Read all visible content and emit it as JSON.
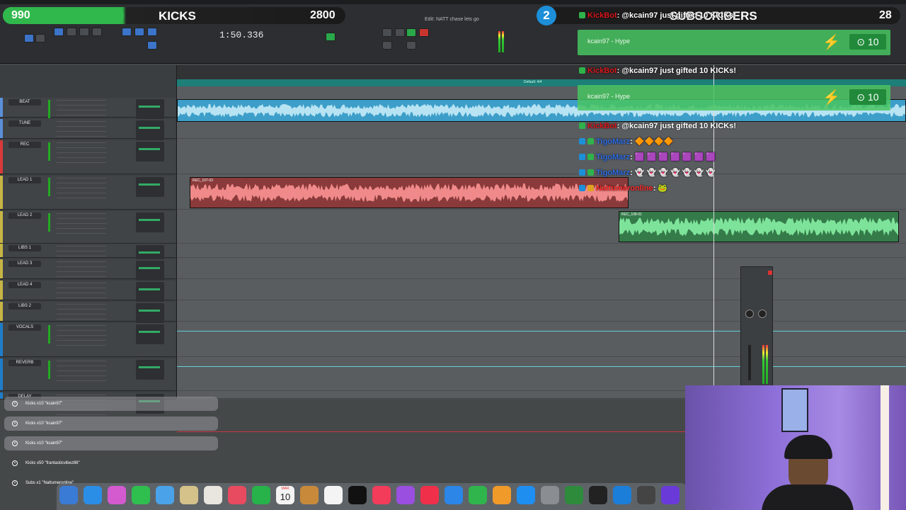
{
  "overlay": {
    "kicks": {
      "count": "990",
      "label": "KICKS",
      "goal": "2800",
      "progress": 0.354
    },
    "subs": {
      "count": "2",
      "label": "SUBSCRIBERS",
      "goal": "28"
    }
  },
  "transport": {
    "counter": "1:50.336",
    "edit_title": "Edit: NATT chase lets go",
    "default_meter": "Default: 4/4"
  },
  "tracks": [
    {
      "name": "BEAT",
      "color": "#5b8fd9"
    },
    {
      "name": "TUNE",
      "color": "#5b8fd9"
    },
    {
      "name": "REC",
      "color": "#d8393b"
    },
    {
      "name": "LEAD 1",
      "color": "#c6b545"
    },
    {
      "name": "LEAD 2",
      "color": "#c6b545"
    },
    {
      "name": "LIBS 1",
      "color": "#c6b545"
    },
    {
      "name": "LEAD 3",
      "color": "#c6b545"
    },
    {
      "name": "LEAD 4",
      "color": "#c6b545"
    },
    {
      "name": "LIBS 2",
      "color": "#c6b545"
    },
    {
      "name": "VOCALS",
      "color": "#1f7cc8"
    },
    {
      "name": "REVERB",
      "color": "#1f7cc8"
    },
    {
      "name": "DELAY",
      "color": "#1f7cc8"
    }
  ],
  "regions": {
    "lead1": "REC_107-03",
    "lead2": "REC_108-01"
  },
  "chat": {
    "hype1_user": "kcain97",
    "hype1_word": "Hype",
    "hype1_count": "10",
    "hype2_user": "kcain97",
    "hype2_word": "Hype",
    "hype2_count": "10",
    "line0_bot": "KickBot",
    "line0_text": ": @kcain97 just gifted 10 KICKs!",
    "line1_bot": "KickBot",
    "line1_text": ": @kcain97 just gifted 10 KICKs!",
    "line2_bot": "KickBot",
    "line2_text": ": @kcain97 just gifted 10 KICKs!",
    "line3_nick": "TigoMarz",
    "line3_text": ": 🔶🔶🔶🔶",
    "line4_nick": "TigoMarz",
    "line4_text": ": 🟪 🟪 🟪 🟪 🟪 🟪 🟪",
    "line5_nick": "TigoMarz",
    "line5_text": ": 👻 👻 👻 👻 👻 👻 👻",
    "line6_nick": "Nattumeronline",
    "line6_text": ": 🐸"
  },
  "alerts": [
    "Kicks x10 \"kcain97\"",
    "Kicks x10 \"kcain97\"",
    "Kicks x10 \"kcain97\"",
    "Kicks x50 \"frantasticvibez86\"",
    "Subs x1 \"Nattumeronline\""
  ],
  "dock": {
    "calendar_month": "MAR",
    "calendar_day": "10"
  },
  "colors": {
    "kicks_green": "#31b84c",
    "hype_green": "#48c460",
    "bot_red": "#d9161b",
    "region_blue": "#3d9fc9",
    "region_red": "#8a3a3a",
    "region_green": "#357b4a"
  }
}
